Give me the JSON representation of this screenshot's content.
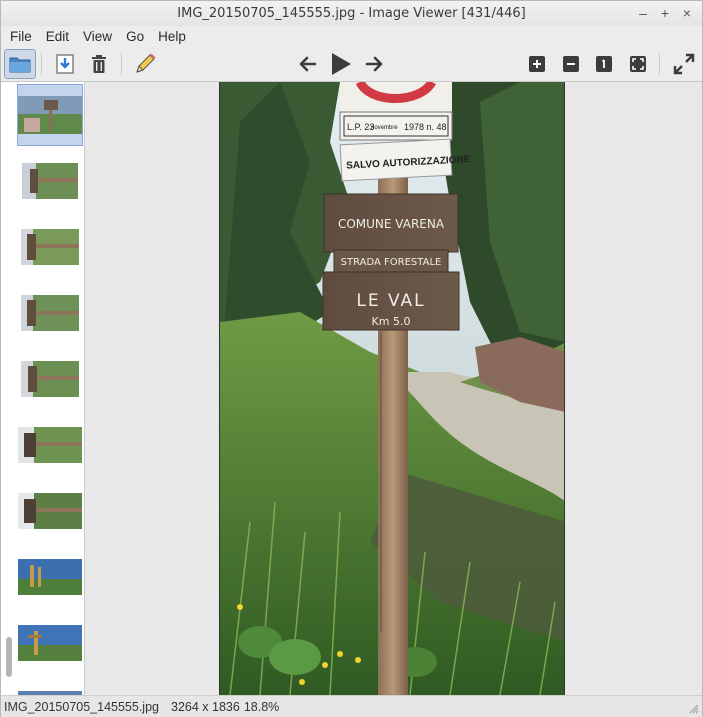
{
  "window": {
    "title": "IMG_20150705_145555.jpg - Image Viewer [431/446]",
    "controls": [
      "minimize",
      "maximize",
      "close"
    ]
  },
  "menu": [
    "File",
    "Edit",
    "View",
    "Go",
    "Help"
  ],
  "toolbar": {
    "left": [
      {
        "name": "open-folder-button",
        "icon": "folder-icon",
        "active": true
      },
      {
        "name": "save-button",
        "icon": "save-icon"
      },
      {
        "name": "delete-button",
        "icon": "trash-icon"
      },
      {
        "name": "edit-button",
        "icon": "pencil-icon"
      }
    ],
    "center": [
      {
        "name": "previous-button",
        "icon": "arrow-left-icon"
      },
      {
        "name": "slideshow-button",
        "icon": "play-icon"
      },
      {
        "name": "next-button",
        "icon": "arrow-right-icon"
      }
    ],
    "right": [
      {
        "name": "zoom-in-button",
        "icon": "zoom-in-icon"
      },
      {
        "name": "zoom-out-button",
        "icon": "zoom-out-icon"
      },
      {
        "name": "original-size-button",
        "icon": "original-size-icon"
      },
      {
        "name": "fit-button",
        "icon": "fit-window-icon"
      },
      {
        "name": "fullscreen-button",
        "icon": "fullscreen-icon"
      }
    ]
  },
  "thumbnails": [
    {
      "orientation": "portrait",
      "selected": true
    },
    {
      "orientation": "landscape-rotated"
    },
    {
      "orientation": "landscape-rotated"
    },
    {
      "orientation": "landscape-rotated"
    },
    {
      "orientation": "landscape-rotated"
    },
    {
      "orientation": "landscape-rotated"
    },
    {
      "orientation": "landscape-rotated"
    },
    {
      "orientation": "landscape"
    },
    {
      "orientation": "landscape"
    },
    {
      "orientation": "landscape"
    }
  ],
  "photo": {
    "sign_top": "L.P. 23 novembre 1978 n. 48",
    "sign_top_left": "L.P. 23",
    "sign_top_mid": "novembre",
    "sign_top_right": "1978 n. 48",
    "sign_auth": "SALVO AUTORIZZAZIONE",
    "sign_line1": "COMUNE VARENA",
    "sign_line2": "STRADA FORESTALE",
    "sign_line3": "LE VAL",
    "sign_line4": "Km 5.0"
  },
  "status": {
    "filename": "IMG_20150705_145555.jpg",
    "dimensions": "3264 x 1836",
    "zoom": "18.8%"
  }
}
